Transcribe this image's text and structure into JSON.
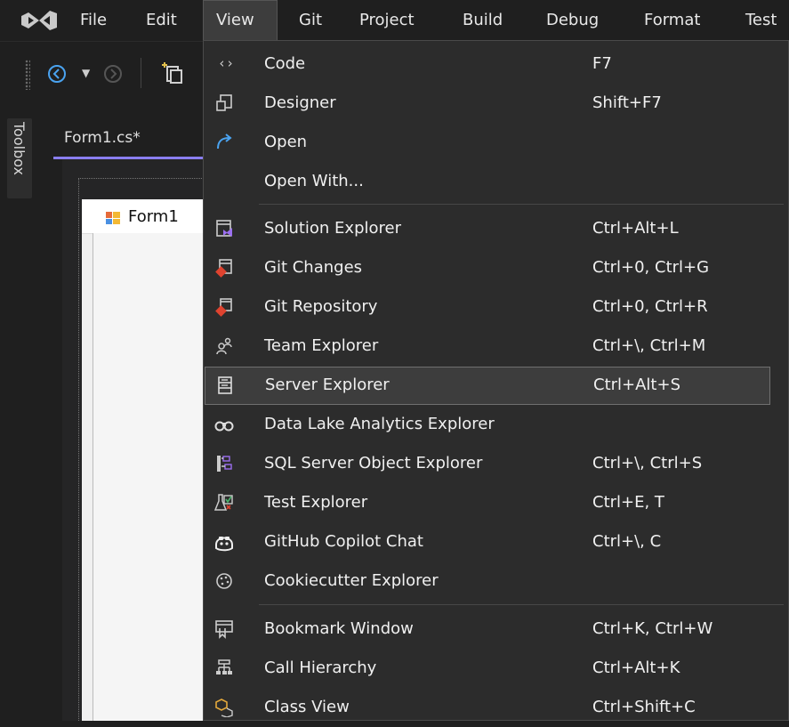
{
  "menubar": {
    "items": [
      "File",
      "Edit",
      "View",
      "Git",
      "Project",
      "Build",
      "Debug",
      "Format",
      "Test"
    ],
    "active": "View"
  },
  "toolbox": {
    "label": "Toolbox"
  },
  "document": {
    "tab_label": "Form1.cs*",
    "form_title": "Form1"
  },
  "view_menu": {
    "items": [
      {
        "label": "Code",
        "shortcut": "F7",
        "icon": "code-icon"
      },
      {
        "label": "Designer",
        "shortcut": "Shift+F7",
        "icon": "designer-icon"
      },
      {
        "label": "Open",
        "shortcut": "",
        "icon": "open-icon"
      },
      {
        "label": "Open With...",
        "shortcut": "",
        "icon": ""
      },
      {
        "label": "Solution Explorer",
        "shortcut": "Ctrl+Alt+L",
        "icon": "solution-explorer-icon"
      },
      {
        "label": "Git Changes",
        "shortcut": "Ctrl+0, Ctrl+G",
        "icon": "git-changes-icon"
      },
      {
        "label": "Git Repository",
        "shortcut": "Ctrl+0, Ctrl+R",
        "icon": "git-repository-icon"
      },
      {
        "label": "Team Explorer",
        "shortcut": "Ctrl+\\, Ctrl+M",
        "icon": "team-explorer-icon"
      },
      {
        "label": "Server Explorer",
        "shortcut": "Ctrl+Alt+S",
        "icon": "server-explorer-icon"
      },
      {
        "label": "Data Lake Analytics Explorer",
        "shortcut": "",
        "icon": "data-lake-icon"
      },
      {
        "label": "SQL Server Object Explorer",
        "shortcut": "Ctrl+\\, Ctrl+S",
        "icon": "sql-server-icon"
      },
      {
        "label": "Test Explorer",
        "shortcut": "Ctrl+E, T",
        "icon": "test-explorer-icon"
      },
      {
        "label": "GitHub Copilot Chat",
        "shortcut": "Ctrl+\\, C",
        "icon": "copilot-icon"
      },
      {
        "label": "Cookiecutter Explorer",
        "shortcut": "",
        "icon": "cookiecutter-icon"
      },
      {
        "label": "Bookmark Window",
        "shortcut": "Ctrl+K, Ctrl+W",
        "icon": "bookmark-icon"
      },
      {
        "label": "Call Hierarchy",
        "shortcut": "Ctrl+Alt+K",
        "icon": "call-hierarchy-icon"
      },
      {
        "label": "Class View",
        "shortcut": "Ctrl+Shift+C",
        "icon": "class-view-icon"
      }
    ],
    "highlighted": "Server Explorer"
  },
  "colors": {
    "background": "#1f1f1f",
    "menu_bg": "#2c2c2c",
    "accent_tab": "#8a7ef0",
    "git_red": "#e0432f",
    "solution_purple": "#9b6ff0",
    "open_blue": "#4aa3f0"
  }
}
